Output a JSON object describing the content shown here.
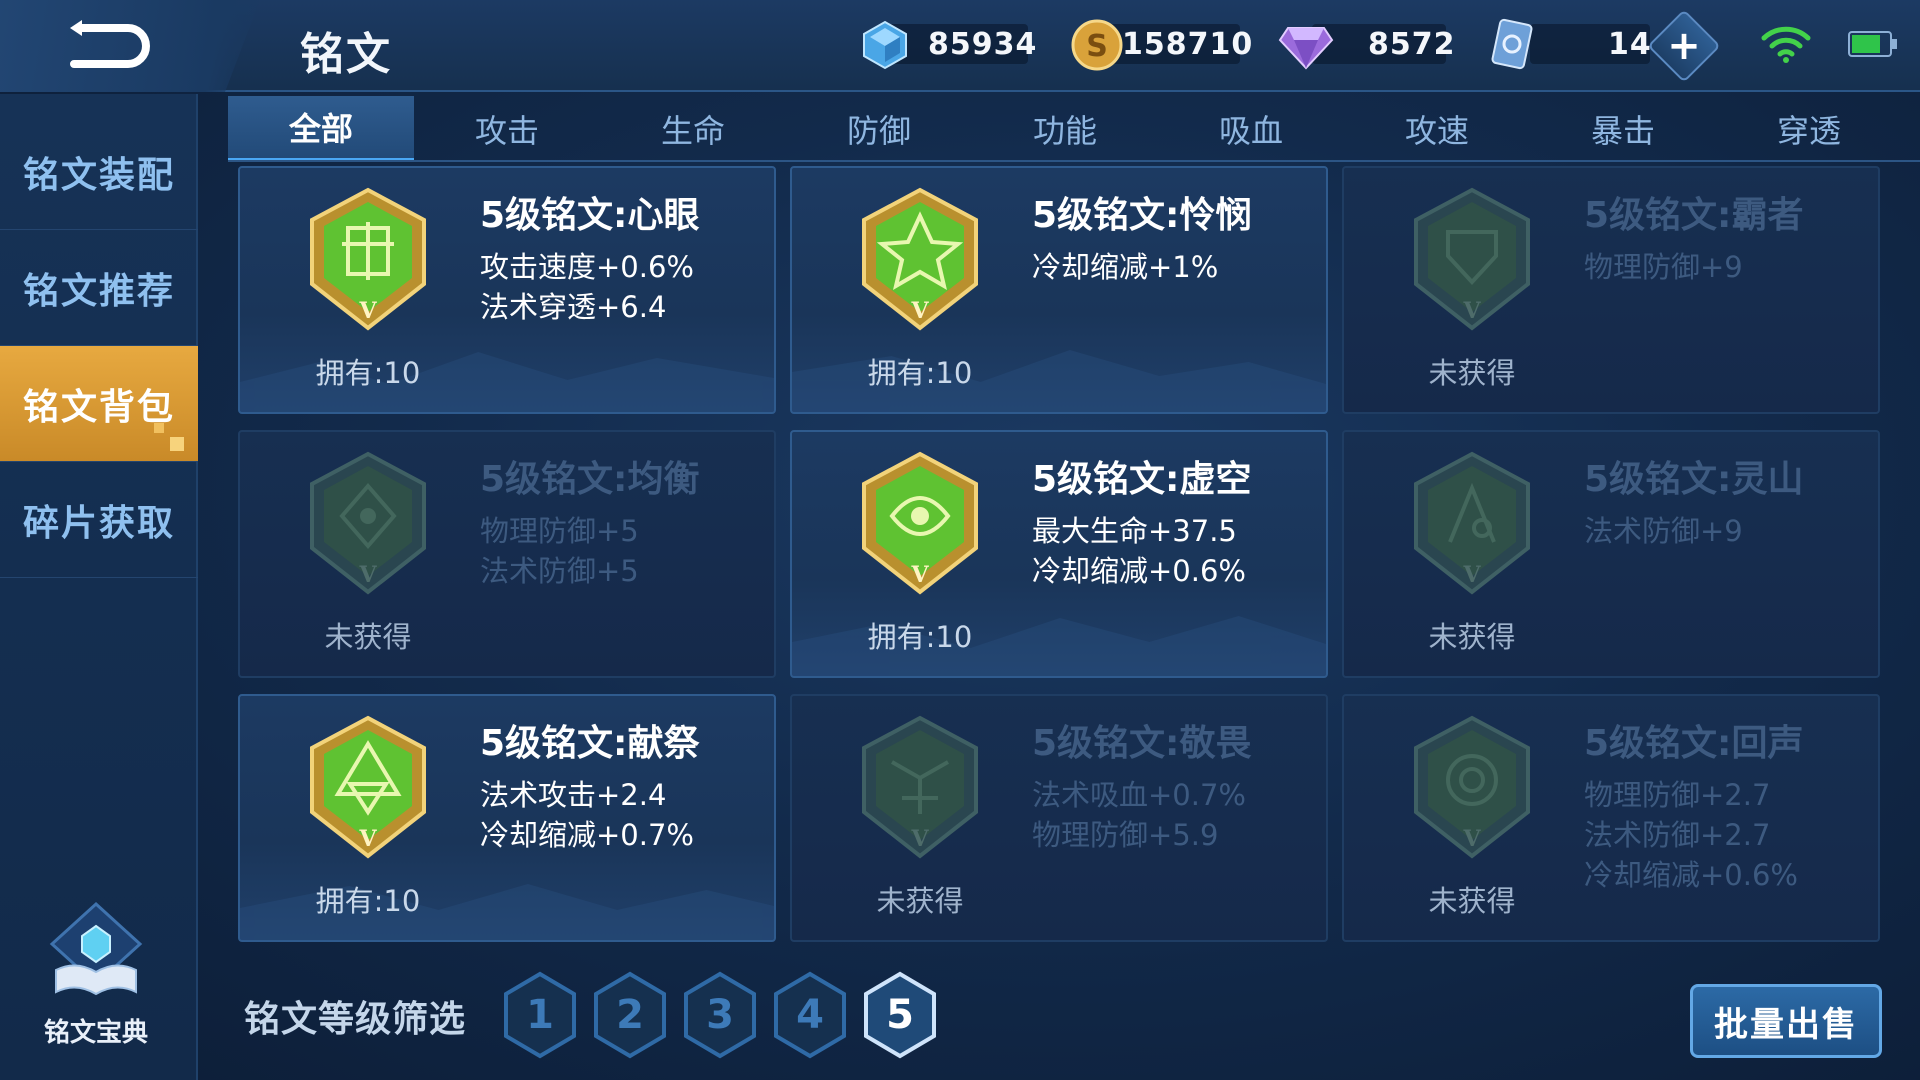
{
  "header": {
    "title": "铭文",
    "resources": [
      {
        "name": "diamond-crystal",
        "value": "85934"
      },
      {
        "name": "gold-coin",
        "value": "158710"
      },
      {
        "name": "purple-gem",
        "value": "8572"
      },
      {
        "name": "inscription-ticket",
        "value": "14"
      }
    ]
  },
  "sidebar": {
    "items": [
      {
        "label": "铭文装配"
      },
      {
        "label": "铭文推荐"
      },
      {
        "label": "铭文背包"
      },
      {
        "label": "碎片获取"
      }
    ],
    "active_index": 2,
    "codex_label": "铭文宝典"
  },
  "tabs": [
    {
      "label": "全部"
    },
    {
      "label": "攻击"
    },
    {
      "label": "生命"
    },
    {
      "label": "防御"
    },
    {
      "label": "功能"
    },
    {
      "label": "吸血"
    },
    {
      "label": "攻速"
    },
    {
      "label": "暴击"
    },
    {
      "label": "穿透"
    }
  ],
  "active_tab": 0,
  "cards": [
    {
      "name": "5级铭文:心眼",
      "stats": [
        "攻击速度+0.6%",
        "法术穿透+6.4"
      ],
      "owned": "拥有:10",
      "locked": false
    },
    {
      "name": "5级铭文:怜悯",
      "stats": [
        "冷却缩减+1%"
      ],
      "owned": "拥有:10",
      "locked": false
    },
    {
      "name": "5级铭文:霸者",
      "stats": [
        "物理防御+9"
      ],
      "owned": "未获得",
      "locked": true
    },
    {
      "name": "5级铭文:均衡",
      "stats": [
        "物理防御+5",
        "法术防御+5"
      ],
      "owned": "未获得",
      "locked": true
    },
    {
      "name": "5级铭文:虚空",
      "stats": [
        "最大生命+37.5",
        "冷却缩减+0.6%"
      ],
      "owned": "拥有:10",
      "locked": false
    },
    {
      "name": "5级铭文:灵山",
      "stats": [
        "法术防御+9"
      ],
      "owned": "未获得",
      "locked": true
    },
    {
      "name": "5级铭文:献祭",
      "stats": [
        "法术攻击+2.4",
        "冷却缩减+0.7%"
      ],
      "owned": "拥有:10",
      "locked": false
    },
    {
      "name": "5级铭文:敬畏",
      "stats": [
        "法术吸血+0.7%",
        "物理防御+5.9"
      ],
      "owned": "未获得",
      "locked": true
    },
    {
      "name": "5级铭文:回声",
      "stats": [
        "物理防御+2.7",
        "法术防御+2.7",
        "冷却缩减+0.6%"
      ],
      "owned": "未获得",
      "locked": true
    }
  ],
  "filter": {
    "label": "铭文等级筛选",
    "levels": [
      "1",
      "2",
      "3",
      "4",
      "5"
    ],
    "active_level": "5"
  },
  "sell_button": "批量出售",
  "colors": {
    "accent_gold": "#e7a940",
    "tab_active": "#2f5c8f",
    "gem_green": "#5fc232",
    "gem_gold": "#e2b74b",
    "locked_text": "#3d5a80"
  }
}
